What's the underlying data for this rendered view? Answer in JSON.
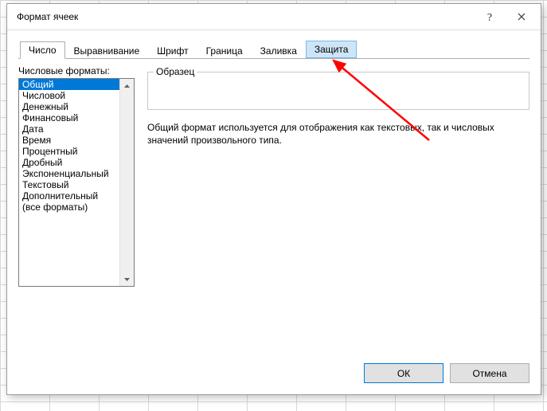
{
  "dialog": {
    "title": "Формат ячеек"
  },
  "tabs": [
    {
      "label": "Число"
    },
    {
      "label": "Выравнивание"
    },
    {
      "label": "Шрифт"
    },
    {
      "label": "Граница"
    },
    {
      "label": "Заливка"
    },
    {
      "label": "Защита"
    }
  ],
  "categoryLabel": "Числовые форматы:",
  "categories": [
    "Общий",
    "Числовой",
    "Денежный",
    "Финансовый",
    "Дата",
    "Время",
    "Процентный",
    "Дробный",
    "Экспоненциальный",
    "Текстовый",
    "Дополнительный",
    "(все форматы)"
  ],
  "selectedCategoryIndex": 0,
  "sample": {
    "legend": "Образец",
    "value": ""
  },
  "description": "Общий формат используется для отображения как текстовых, так и числовых значений произвольного типа.",
  "buttons": {
    "ok": "ОК",
    "cancel": "Отмена"
  }
}
